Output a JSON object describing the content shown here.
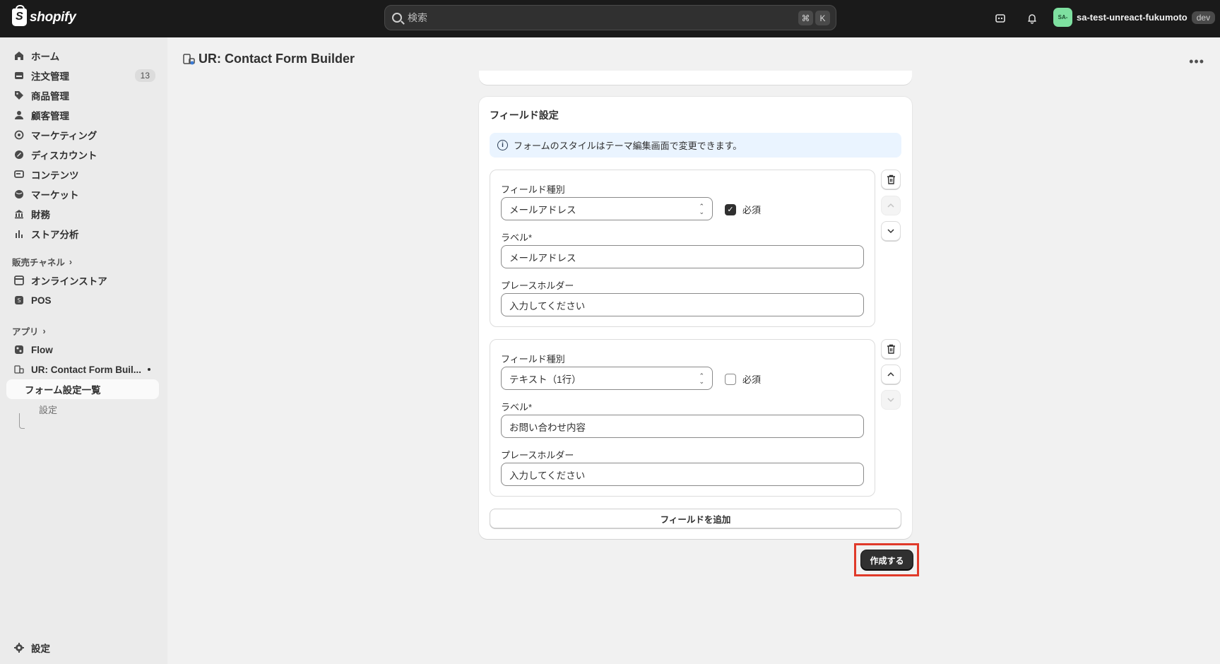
{
  "topbar": {
    "brand": "shopify",
    "search_placeholder": "検索",
    "shortcut_cmd": "⌘",
    "shortcut_key": "K",
    "avatar_initials": "SA-",
    "account_name": "sa-test-unreact-fukumoto",
    "env_badge": "dev"
  },
  "sidebar": {
    "items": [
      {
        "label": "ホーム",
        "icon": "home-icon"
      },
      {
        "label": "注文管理",
        "icon": "orders-icon",
        "badge": "13"
      },
      {
        "label": "商品管理",
        "icon": "tag-icon"
      },
      {
        "label": "顧客管理",
        "icon": "person-icon"
      },
      {
        "label": "マーケティング",
        "icon": "target-icon"
      },
      {
        "label": "ディスカウント",
        "icon": "discount-icon"
      },
      {
        "label": "コンテンツ",
        "icon": "content-icon"
      },
      {
        "label": "マーケット",
        "icon": "globe-icon"
      },
      {
        "label": "財務",
        "icon": "bank-icon"
      },
      {
        "label": "ストア分析",
        "icon": "chart-icon"
      }
    ],
    "sales_channels_heading": "販売チャネル",
    "sales_channels": [
      {
        "label": "オンラインストア",
        "icon": "storefront-icon"
      },
      {
        "label": "POS",
        "icon": "pos-icon"
      }
    ],
    "apps_heading": "アプリ",
    "apps": [
      {
        "label": "Flow",
        "icon": "flow-icon"
      },
      {
        "label": "UR: Contact Form Buil...",
        "icon": "app-icon"
      }
    ],
    "app_subitems": [
      {
        "label": "フォーム設定一覧"
      },
      {
        "label": "設定"
      }
    ],
    "settings_label": "設定"
  },
  "page": {
    "title": "UR: Contact Form Builder"
  },
  "card": {
    "title": "フィールド設定",
    "banner_text": "フォームのスタイルはテーマ編集画面で変更できます。",
    "fields": [
      {
        "type_label": "フィールド種別",
        "type_value": "メールアドレス",
        "required_label": "必須",
        "required": true,
        "label_label": "ラベル*",
        "label_value": "メールアドレス",
        "placeholder_label": "プレースホルダー",
        "placeholder_value": "入力してください"
      },
      {
        "type_label": "フィールド種別",
        "type_value": "テキスト（1行）",
        "required_label": "必須",
        "required": false,
        "label_label": "ラベル*",
        "label_value": "お問い合わせ内容",
        "placeholder_label": "プレースホルダー",
        "placeholder_value": "入力してください"
      }
    ],
    "add_field_label": "フィールドを追加"
  },
  "actions": {
    "create_label": "作成する"
  },
  "colors": {
    "topbar_bg": "#1a1a1a",
    "highlight": "#e03a2a",
    "primary_button": "#303030",
    "banner_bg": "#eaf4ff"
  }
}
